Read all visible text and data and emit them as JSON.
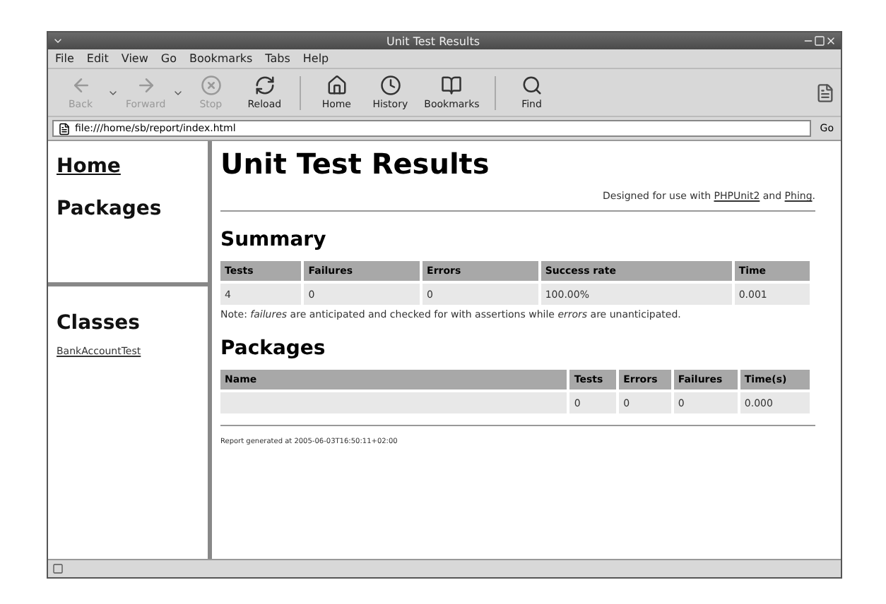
{
  "window": {
    "title": "Unit Test Results"
  },
  "menu": [
    "File",
    "Edit",
    "View",
    "Go",
    "Bookmarks",
    "Tabs",
    "Help"
  ],
  "toolbar": {
    "groups": [
      [
        {
          "label": "Back",
          "disabled": true,
          "dropdown": true
        },
        {
          "label": "Forward",
          "disabled": true,
          "dropdown": true
        },
        {
          "label": "Stop",
          "disabled": true,
          "dropdown": false
        },
        {
          "label": "Reload",
          "disabled": false,
          "dropdown": false
        }
      ],
      [
        {
          "label": "Home",
          "disabled": false,
          "dropdown": false
        },
        {
          "label": "History",
          "disabled": false,
          "dropdown": false
        },
        {
          "label": "Bookmarks",
          "disabled": false,
          "dropdown": false
        }
      ],
      [
        {
          "label": "Find",
          "disabled": false,
          "dropdown": false
        }
      ]
    ]
  },
  "address": {
    "value": "file:///home/sb/report/index.html",
    "go": "Go"
  },
  "sidebar": {
    "top": [
      {
        "label": "Home",
        "link": true
      },
      {
        "label": "Packages",
        "link": false
      }
    ],
    "classes_title": "Classes",
    "classes": [
      "BankAccountTest"
    ]
  },
  "page": {
    "title": "Unit Test Results",
    "credit": [
      {
        "kind": "text",
        "text": "Designed for use with "
      },
      {
        "kind": "link",
        "text": "PHPUnit2"
      },
      {
        "kind": "text",
        "text": " and "
      },
      {
        "kind": "link",
        "text": "Phing"
      },
      {
        "kind": "text",
        "text": "."
      }
    ],
    "summary": {
      "heading": "Summary",
      "columns": [
        "Tests",
        "Failures",
        "Errors",
        "Success rate",
        "Time"
      ],
      "rows": [
        [
          "4",
          "0",
          "0",
          "100.00%",
          "0.001"
        ]
      ],
      "note": "Note: *failures* are anticipated and checked for with assertions while *errors* are unanticipated."
    },
    "packages": {
      "heading": "Packages",
      "columns": [
        "Name",
        "Tests",
        "Errors",
        "Failures",
        "Time(s)"
      ],
      "rows": [
        [
          "",
          "0",
          "0",
          "0",
          "0.000"
        ]
      ]
    },
    "footer": "Report generated at 2005-06-03T16:50:11+02:00"
  }
}
